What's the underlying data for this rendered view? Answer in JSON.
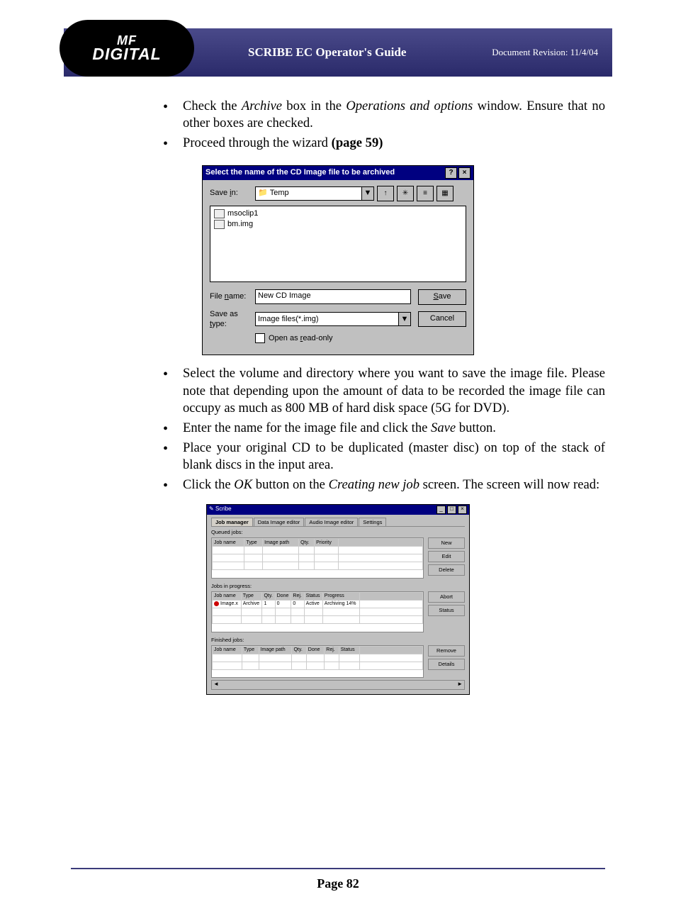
{
  "header": {
    "title": "SCRIBE EC Operator's Guide",
    "revision": "Document Revision: 11/4/04",
    "logo_top": "MF",
    "logo_bottom": "DIGITAL"
  },
  "bullets_top": {
    "b1_a": "Check the ",
    "b1_i1": "Archive",
    "b1_b": " box in the ",
    "b1_i2": "Operations and options",
    "b1_c": " window. Ensure that no other boxes are checked.",
    "b2_a": "Proceed through the wizard ",
    "b2_bold": "(page 59)"
  },
  "dialog1": {
    "title": "Select the name of the CD Image file to be archived",
    "help": "?",
    "close": "×",
    "save_in_lbl": "Save in:",
    "save_in_lbl_u": "i",
    "save_in_val": "Temp",
    "tb_up": "↑",
    "tb_new": "✳",
    "tb_list": "≡",
    "tb_det": "▦",
    "files": [
      "msoclip1",
      "bm.img"
    ],
    "file_name_lbl": "File name:",
    "file_name_lbl_u": "n",
    "file_name_val": "New CD Image",
    "save_btn": "Save",
    "save_btn_u": "S",
    "type_lbl": "Save as type:",
    "type_lbl_u": "t",
    "type_val": "Image files(*.img)",
    "cancel_btn": "Cancel",
    "readonly_lbl": "Open as read-only",
    "readonly_lbl_u": "r"
  },
  "bullets_bottom": {
    "b1": "Select the volume and directory where you want to save the image file. Please note that depending upon the amount of data to be recorded the image file can occupy as much as 800 MB of hard disk space (5G for DVD).",
    "b2_a": "Enter the name for the image file and click the ",
    "b2_i": "Save",
    "b2_b": " button.",
    "b3": "Place your original CD to be duplicated (master disc) on top of the stack of blank discs in the input area.",
    "b4_a": "Click the ",
    "b4_i1": "OK",
    "b4_b": " button on the ",
    "b4_i2": "Creating new job",
    "b4_c": " screen. The screen will now read:"
  },
  "dialog2": {
    "title": "Scribe",
    "tabs": [
      "Job manager",
      "Data Image editor",
      "Audio Image editor",
      "Settings"
    ],
    "sect1": "Queued jobs:",
    "cols1": [
      "Job name",
      "Type",
      "Image path",
      "Qty.",
      "Priority"
    ],
    "btns1": [
      "New",
      "Edit",
      "Delete"
    ],
    "sect2": "Jobs in progress:",
    "cols2": [
      "Job name",
      "Type",
      "Qty.",
      "Done",
      "Rej.",
      "Status",
      "Progress"
    ],
    "row2": {
      "name": "Image.x",
      "type": "Archive",
      "qty": "1",
      "done": "0",
      "rej": "0",
      "status": "Active",
      "progress": "Archiving 14%"
    },
    "btns2": [
      "Abort",
      "Status"
    ],
    "sect3": "Finished jobs:",
    "cols3": [
      "Job name",
      "Type",
      "Image path",
      "Qty.",
      "Done",
      "Rej.",
      "Status"
    ],
    "btns3": [
      "Remove",
      "Details"
    ]
  },
  "footer": {
    "page": "Page 82"
  }
}
